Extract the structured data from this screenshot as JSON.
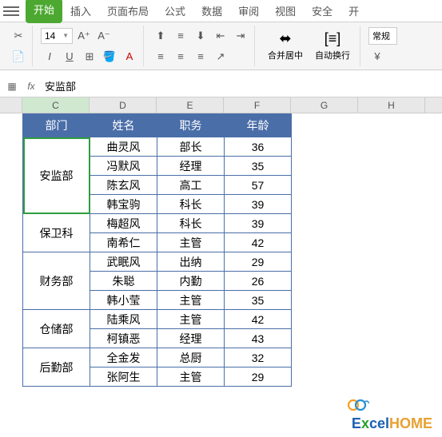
{
  "ribbon": {
    "tabs": [
      "开始",
      "插入",
      "页面布局",
      "公式",
      "数据",
      "审阅",
      "视图",
      "安全",
      "开"
    ],
    "active_index": 0
  },
  "toolbar": {
    "font_size": "14",
    "merge_label": "合并居中",
    "wrap_label": "自动换行",
    "format_label": "常规"
  },
  "formula_bar": {
    "value": "安监部"
  },
  "columns": [
    "C",
    "D",
    "E",
    "F",
    "G",
    "H"
  ],
  "selected_col": "C",
  "table": {
    "headers": [
      "部门",
      "姓名",
      "职务",
      "年龄"
    ],
    "departments": [
      {
        "name": "安监部",
        "rowspan": 4,
        "selected": true,
        "rows": [
          {
            "name": "曲灵风",
            "role": "部长",
            "age": "36"
          },
          {
            "name": "冯默风",
            "role": "经理",
            "age": "35"
          },
          {
            "name": "陈玄风",
            "role": "高工",
            "age": "57"
          },
          {
            "name": "韩宝驹",
            "role": "科长",
            "age": "39"
          }
        ]
      },
      {
        "name": "保卫科",
        "rowspan": 2,
        "rows": [
          {
            "name": "梅超风",
            "role": "科长",
            "age": "39"
          },
          {
            "name": "南希仁",
            "role": "主管",
            "age": "42"
          }
        ]
      },
      {
        "name": "财务部",
        "rowspan": 3,
        "rows": [
          {
            "name": "武眠风",
            "role": "出纳",
            "age": "29"
          },
          {
            "name": "朱聪",
            "role": "内勤",
            "age": "26"
          },
          {
            "name": "韩小莹",
            "role": "主管",
            "age": "35"
          }
        ]
      },
      {
        "name": "仓储部",
        "rowspan": 2,
        "rows": [
          {
            "name": "陆乘风",
            "role": "主管",
            "age": "42"
          },
          {
            "name": "柯镇恶",
            "role": "经理",
            "age": "43"
          }
        ]
      },
      {
        "name": "后勤部",
        "rowspan": 2,
        "rows": [
          {
            "name": "全金发",
            "role": "总厨",
            "age": "32"
          },
          {
            "name": "张阿生",
            "role": "主管",
            "age": "29"
          }
        ]
      }
    ]
  },
  "watermark": {
    "text1": "E",
    "text2": "x",
    "text3": "cel",
    "text4": "H",
    "text5": "O",
    "text6": "ME"
  }
}
